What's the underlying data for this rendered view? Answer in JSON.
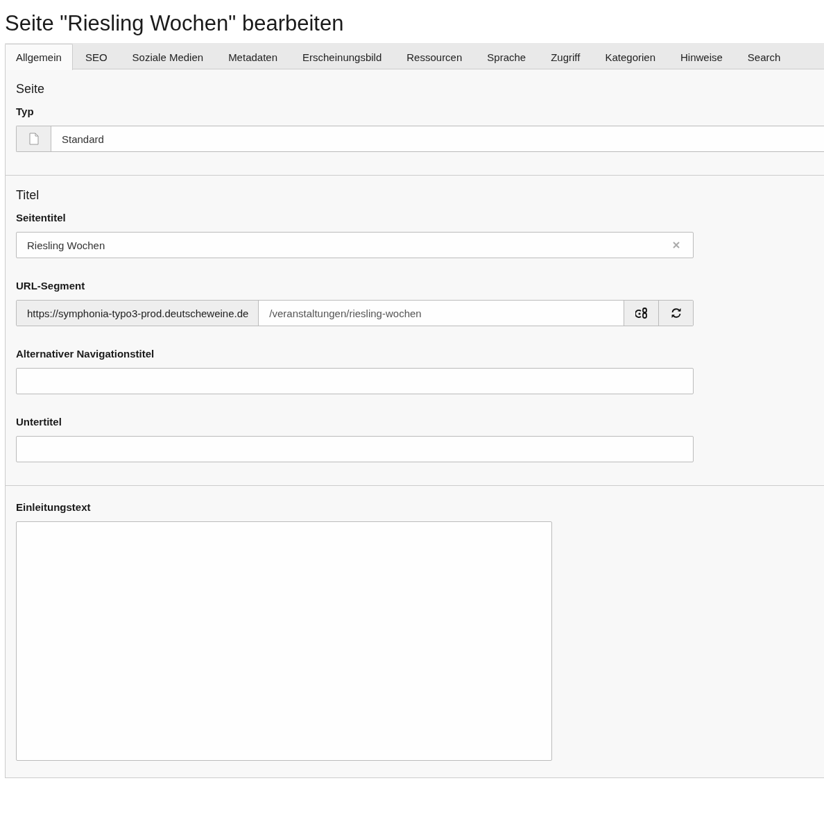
{
  "page_title": "Seite \"Riesling Wochen\" bearbeiten",
  "tabs": [
    {
      "label": "Allgemein",
      "selected": true
    },
    {
      "label": "SEO",
      "selected": false
    },
    {
      "label": "Soziale Medien",
      "selected": false
    },
    {
      "label": "Metadaten",
      "selected": false
    },
    {
      "label": "Erscheinungsbild",
      "selected": false
    },
    {
      "label": "Ressourcen",
      "selected": false
    },
    {
      "label": "Sprache",
      "selected": false
    },
    {
      "label": "Zugriff",
      "selected": false
    },
    {
      "label": "Kategorien",
      "selected": false
    },
    {
      "label": "Hinweise",
      "selected": false
    },
    {
      "label": "Search",
      "selected": false
    }
  ],
  "sections": [
    {
      "title": "Seite",
      "fields": [
        {
          "kind": "select",
          "label": "Typ",
          "value": "Standard"
        }
      ]
    },
    {
      "title": "Titel",
      "fields": [
        {
          "kind": "text",
          "label": "Seitentitel",
          "value": "Riesling Wochen",
          "clearable": true
        },
        {
          "kind": "url",
          "label": "URL-Segment",
          "prefix": "https://symphonia-typo3-prod.deutscheweine.de",
          "value": "/veranstaltungen/riesling-wochen"
        },
        {
          "kind": "text",
          "label": "Alternativer Navigationstitel"
        },
        {
          "kind": "text",
          "label": "Untertitel"
        }
      ]
    },
    {
      "fields": [
        {
          "kind": "textarea",
          "label": "Einleitungstext"
        }
      ]
    }
  ]
}
